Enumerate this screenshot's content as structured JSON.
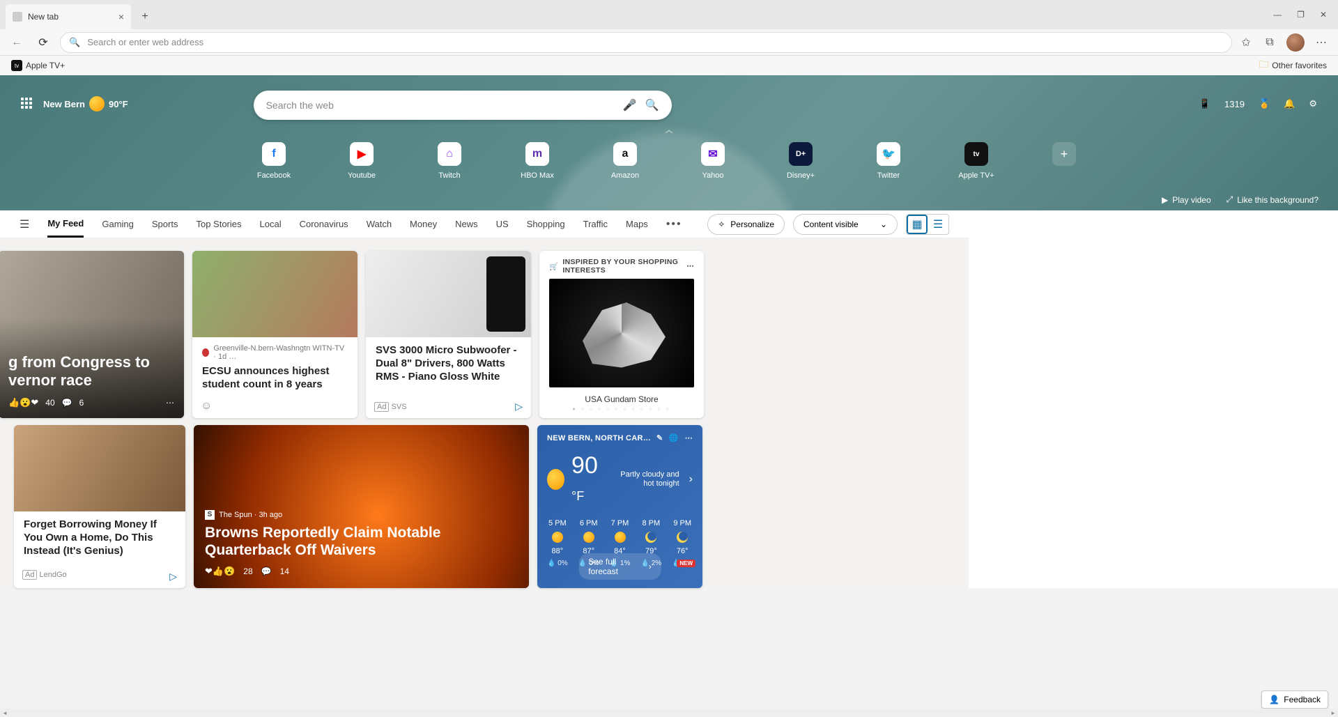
{
  "browser": {
    "tab_title": "New tab",
    "url_placeholder": "Search or enter web address",
    "favorites": [
      {
        "label": "Apple TV+"
      }
    ],
    "other_favorites": "Other favorites"
  },
  "hero": {
    "location": "New Bern",
    "temp_chip": "90°F",
    "search_placeholder": "Search the web",
    "rewards_points": "1319",
    "quicklinks": [
      {
        "name": "Facebook",
        "bg": "#fff",
        "fg": "#1877F2",
        "glyph": "f"
      },
      {
        "name": "Youtube",
        "bg": "#fff",
        "fg": "#FF0000",
        "glyph": "▶"
      },
      {
        "name": "Twitch",
        "bg": "#fff",
        "fg": "#9146FF",
        "glyph": "⨀"
      },
      {
        "name": "HBO Max",
        "bg": "#fff",
        "fg": "#5A2DB0",
        "glyph": "m"
      },
      {
        "name": "Amazon",
        "bg": "#fff",
        "fg": "#111",
        "glyph": "a"
      },
      {
        "name": "Yahoo",
        "bg": "#fff",
        "fg": "#6001D2",
        "glyph": "✉"
      },
      {
        "name": "Disney+",
        "bg": "#0b1a3a",
        "fg": "#fff",
        "glyph": "D"
      },
      {
        "name": "Twitter",
        "bg": "#fff",
        "fg": "#1DA1F2",
        "glyph": "t"
      },
      {
        "name": "Apple TV+",
        "bg": "#111",
        "fg": "#fff",
        "glyph": "tv"
      }
    ],
    "play_video": "Play video",
    "like_bg": "Like this background?"
  },
  "feed_nav": {
    "items": [
      "My Feed",
      "Gaming",
      "Sports",
      "Top Stories",
      "Local",
      "Coronavirus",
      "Watch",
      "Money",
      "News",
      "US",
      "Shopping",
      "Traffic",
      "Maps"
    ],
    "personalize": "Personalize",
    "content_visible": "Content visible"
  },
  "cards": {
    "hero": {
      "title_line1": "g from Congress to",
      "title_line2": "vernor race",
      "like_count": "40",
      "comment_count": "6"
    },
    "ecsu": {
      "source": "Greenville-N.bern-Washngtn WITN-TV · 1d …",
      "headline": "ECSU announces highest student count in 8 years"
    },
    "svs": {
      "headline": "SVS 3000 Micro Subwoofer - Dual 8\" Drivers, 800 Watts RMS - Piano Gloss White",
      "ad_label": "Ad",
      "brand": "SVS"
    },
    "shop": {
      "header": "INSPIRED BY YOUR SHOPPING INTERESTS",
      "store": "USA Gundam Store"
    },
    "lend": {
      "headline": "Forget Borrowing Money If You Own a Home, Do This Instead (It's Genius)",
      "ad_label": "Ad",
      "brand": "LendGo"
    },
    "browns": {
      "source": "The Spun · 3h ago",
      "headline": "Browns Reportedly Claim Notable Quarterback Off Waivers",
      "like_count": "28",
      "comment_count": "14"
    },
    "weather": {
      "location": "NEW BERN, NORTH CAR…",
      "temp": "90",
      "unit": "°F",
      "desc": "Partly cloudy and hot tonight",
      "hours": [
        {
          "t": "5 PM",
          "temp": "88°",
          "icon": "sun",
          "pcp": "0%"
        },
        {
          "t": "6 PM",
          "temp": "87°",
          "icon": "sun",
          "pcp": "0%"
        },
        {
          "t": "7 PM",
          "temp": "84°",
          "icon": "sun",
          "pcp": "1%"
        },
        {
          "t": "8 PM",
          "temp": "79°",
          "icon": "moon",
          "pcp": "2%"
        },
        {
          "t": "9 PM",
          "temp": "76°",
          "icon": "moon",
          "pcp": "4%"
        }
      ],
      "forecast_btn": "See full forecast",
      "new_tag": "NEW"
    }
  },
  "feedback": "Feedback"
}
